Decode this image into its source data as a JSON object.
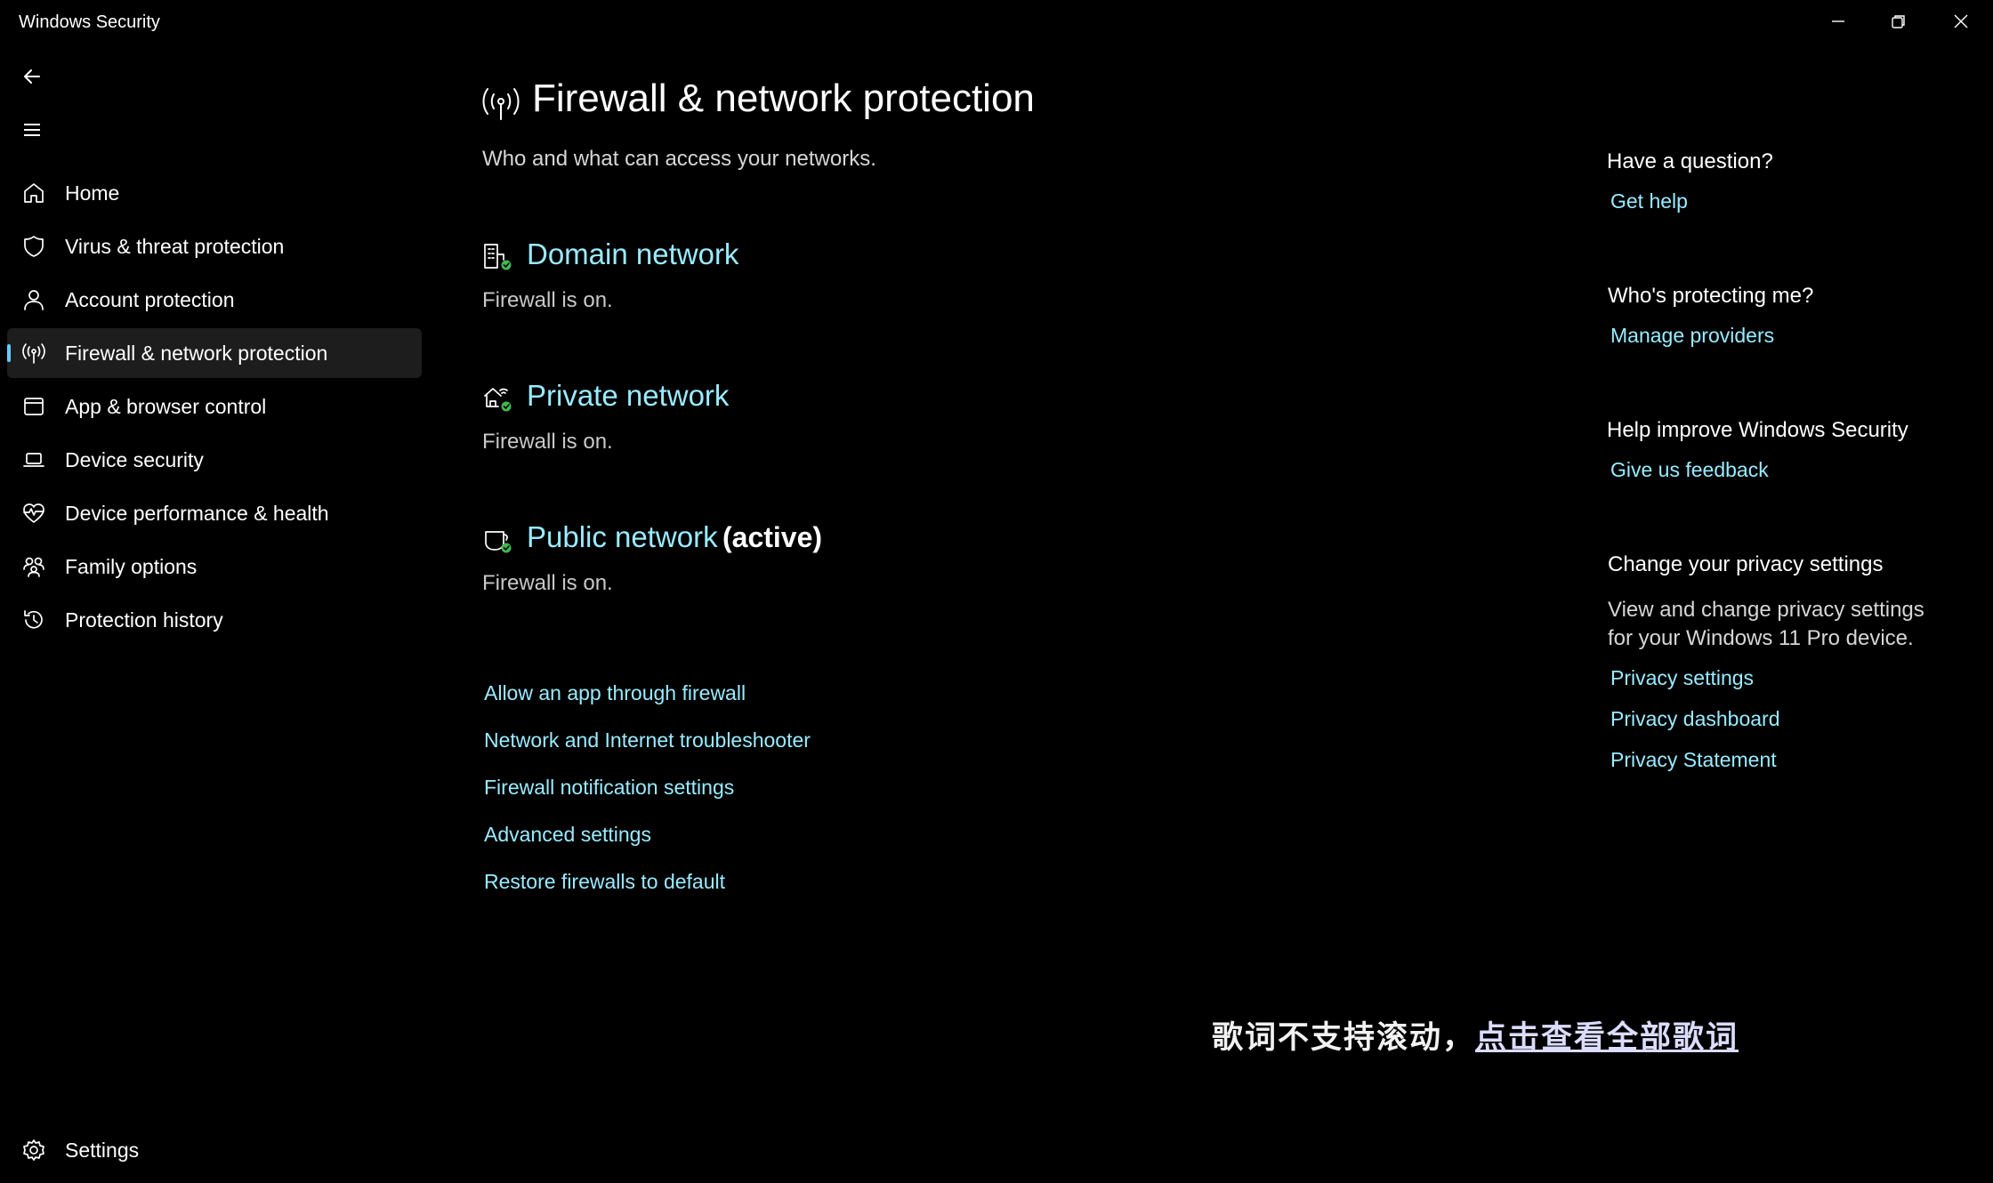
{
  "window": {
    "title": "Windows Security"
  },
  "nav": {
    "items": [
      {
        "label": "Home",
        "icon": "home-icon"
      },
      {
        "label": "Virus & threat protection",
        "icon": "shield-icon"
      },
      {
        "label": "Account protection",
        "icon": "person-icon"
      },
      {
        "label": "Firewall & network protection",
        "icon": "antenna-icon",
        "selected": true
      },
      {
        "label": "App & browser control",
        "icon": "app-window-icon"
      },
      {
        "label": "Device security",
        "icon": "laptop-icon"
      },
      {
        "label": "Device performance & health",
        "icon": "heart-pulse-icon"
      },
      {
        "label": "Family options",
        "icon": "family-icon"
      },
      {
        "label": "Protection history",
        "icon": "history-icon"
      }
    ],
    "settings_label": "Settings"
  },
  "page": {
    "title": "Firewall & network protection",
    "subtitle": "Who and what can access your networks."
  },
  "networks": [
    {
      "name": "Domain network",
      "status": "Firewall is on.",
      "icon": "domain-network-icon"
    },
    {
      "name": "Private network",
      "status": "Firewall is on.",
      "icon": "private-network-icon"
    },
    {
      "name": "Public network",
      "active_label": "(active)",
      "status": "Firewall is on.",
      "icon": "public-network-icon"
    }
  ],
  "links": [
    "Allow an app through firewall",
    "Network and Internet troubleshooter",
    "Firewall notification settings",
    "Advanced settings",
    "Restore firewalls to default"
  ],
  "sidebar": {
    "question_heading": "Have a question?",
    "get_help": "Get help",
    "protecting_heading": "Who's protecting me?",
    "manage_providers": "Manage providers",
    "improve_heading": "Help improve Windows Security",
    "feedback": "Give us feedback",
    "privacy_heading": "Change your privacy settings",
    "privacy_text": "View and change privacy settings for your Windows 11 Pro device.",
    "privacy_settings": "Privacy settings",
    "privacy_dashboard": "Privacy dashboard",
    "privacy_statement": "Privacy Statement"
  },
  "overlay": {
    "lyrics_text": "歌词不支持滚动，",
    "lyrics_link": "点击查看全部歌词"
  },
  "colors": {
    "background": "#000000",
    "link": "#99ebff",
    "accent": "#60cdff",
    "status_ok": "#3fb950"
  }
}
